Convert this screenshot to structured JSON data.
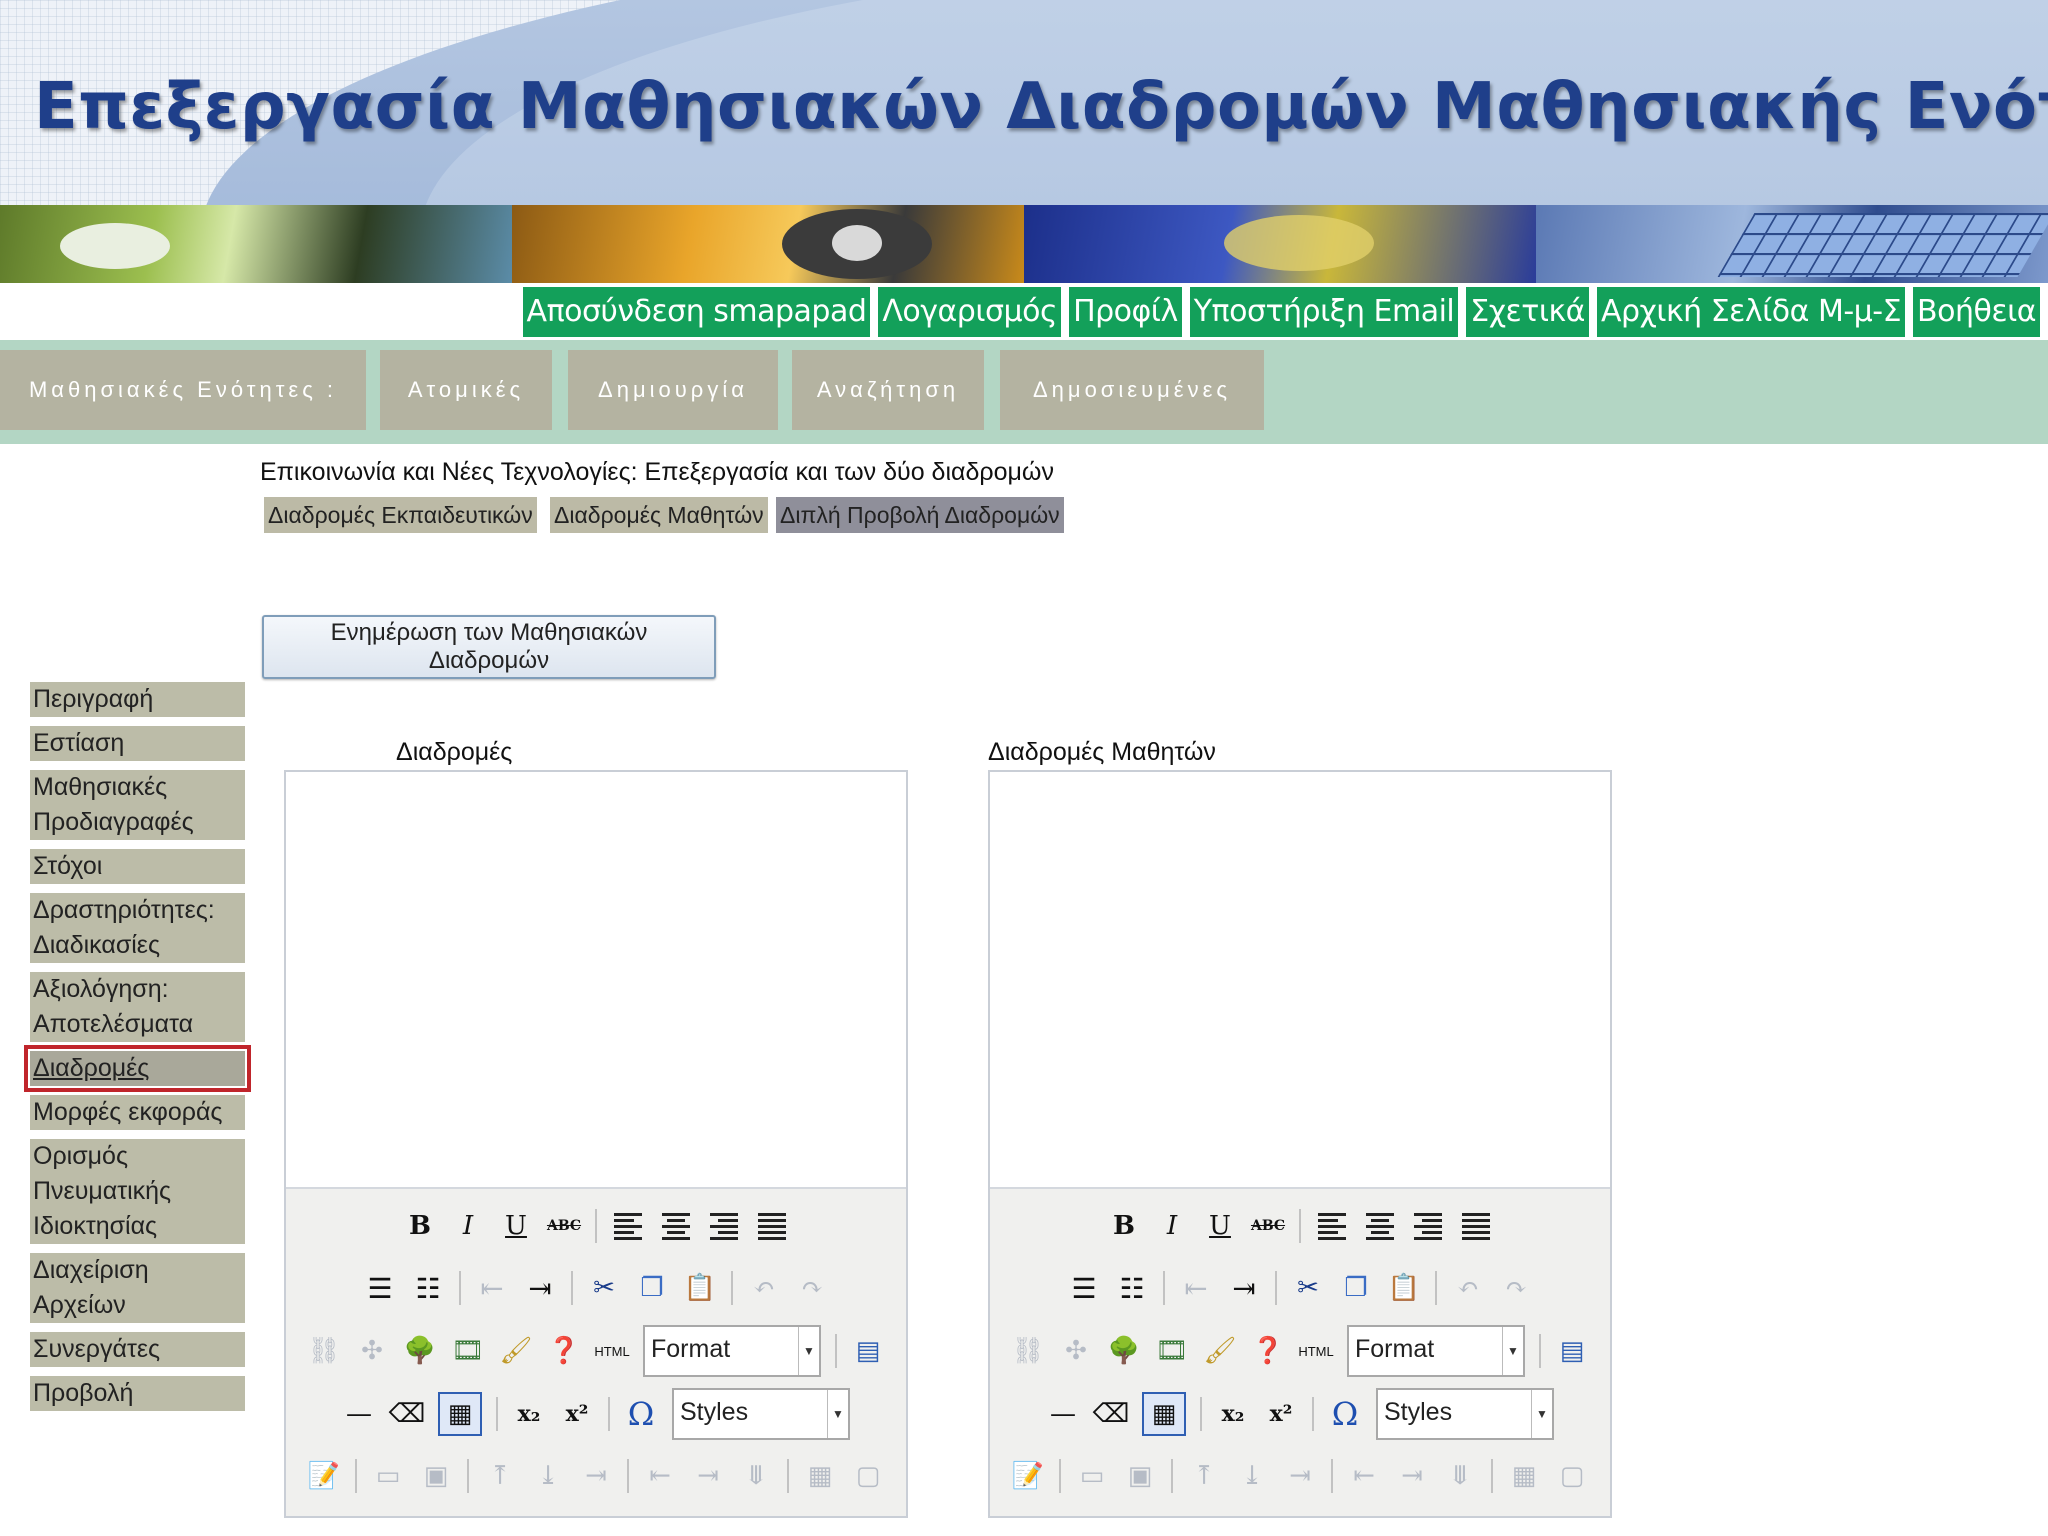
{
  "title": "Επεξεργασία Μαθησιακών Διαδρομών Μαθησιακής Ενότητας",
  "top_nav": [
    "Αποσύνδεση smapapad",
    "Λογαρισμός",
    "Προφίλ",
    "Υποστήριξη Email",
    "Σχετικά",
    "Αρχική Σελίδα Μ-μ-Σ",
    "Βοήθεια"
  ],
  "tabs": [
    "Μαθησιακές Ενότητες :",
    "Ατομικές",
    "Δημιουργία",
    "Αναζήτηση",
    "Δημοσιευμένες"
  ],
  "course_heading": "Επικοινωνία και Νέες Τεχνολογίες: Επεξεργασία και των δύο διαδρομών",
  "view_tabs": [
    "Διαδρομές Εκπαιδευτικών",
    "Διαδρομές Μαθητών",
    "Διπλή Προβολή Διαδρομών"
  ],
  "update_button": "Ενημέρωση των Μαθησιακών Διαδρομών",
  "sidebar": {
    "items": [
      "Περιγραφή",
      "Εστίαση",
      "Μαθησιακές Προδιαγραφές",
      "Στόχοι",
      "Δραστηριότητες: Διαδικασίες",
      "Αξιολόγηση: Αποτελέσματα",
      "Διαδρομές",
      "Μορφές εκφοράς",
      "Ορισμός Πνευματικής Ιδιοκτησίας",
      "Διαχείριση Αρχείων",
      "Συνεργάτες",
      "Προβολή"
    ],
    "active": "Διαδρομές"
  },
  "editors": [
    {
      "label": "Διαδρομές",
      "format": "Format",
      "styles": "Styles"
    },
    {
      "label": "Διαδρομές Μαθητών",
      "format": "Format",
      "styles": "Styles"
    }
  ],
  "toolbar_glyphs": {
    "bold": "B",
    "italic": "I",
    "underline": "U",
    "strike": "ABC",
    "html": "HTML",
    "subscript": "x₂",
    "superscript": "x²",
    "omega": "Ω",
    "undo": "↶",
    "redo": "↷",
    "cut": "✂",
    "hr": "—"
  },
  "colors": {
    "title": "#1f3f8a",
    "top_nav_bg": "#13a05a",
    "tabbar_bg": "#b3d6c4",
    "tab_bg": "#b4b3a1",
    "active_outline": "#c0252b"
  }
}
